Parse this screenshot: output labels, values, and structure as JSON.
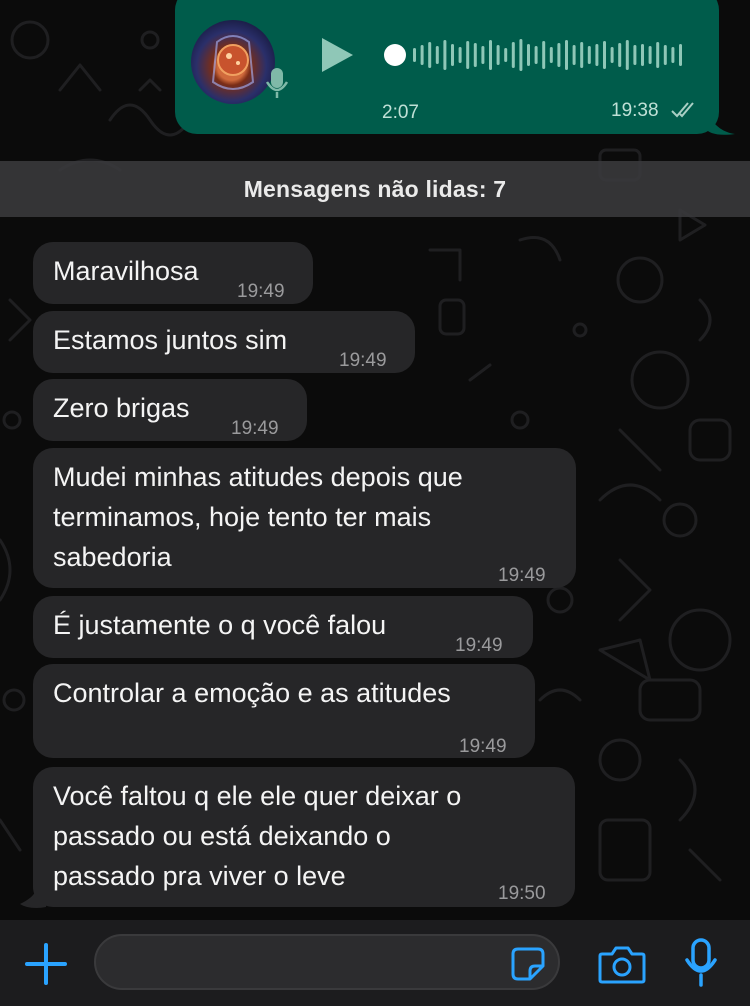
{
  "voice_message": {
    "duration": "2:07",
    "time": "19:38",
    "status": "read",
    "avatar_icon": "profile-avatar",
    "play_icon": "play-icon",
    "mic_icon": "mic-icon",
    "tick_icon": "double-check-icon"
  },
  "unread_divider": {
    "label": "Mensagens não lidas: 7"
  },
  "messages": [
    {
      "text": "Maravilhosa",
      "time": "19:49"
    },
    {
      "text": "Estamos juntos sim",
      "time": "19:49"
    },
    {
      "text": "Zero brigas",
      "time": "19:49"
    },
    {
      "text": "Mudei minhas atitudes depois que\nterminamos, hoje tento ter mais\nsabedoria",
      "time": "19:49"
    },
    {
      "text": "É justamente o q você falou",
      "time": "19:49"
    },
    {
      "text": "Controlar a emoção e as atitudes",
      "time": "19:49"
    },
    {
      "text": "Você faltou q ele ele quer deixar o\npassado ou está deixando o\npassado pra viver o leve",
      "time": "19:50"
    }
  ],
  "input_bar": {
    "placeholder": "",
    "icons": [
      "plus-icon",
      "sticker-icon",
      "camera-icon",
      "mic-icon"
    ]
  },
  "colors": {
    "accent": "#2aa3ff",
    "outgoing_bubble": "#005c4b",
    "incoming_bubble": "#262628",
    "background": "#0b0b0b",
    "divider": "#3a3a3c"
  }
}
